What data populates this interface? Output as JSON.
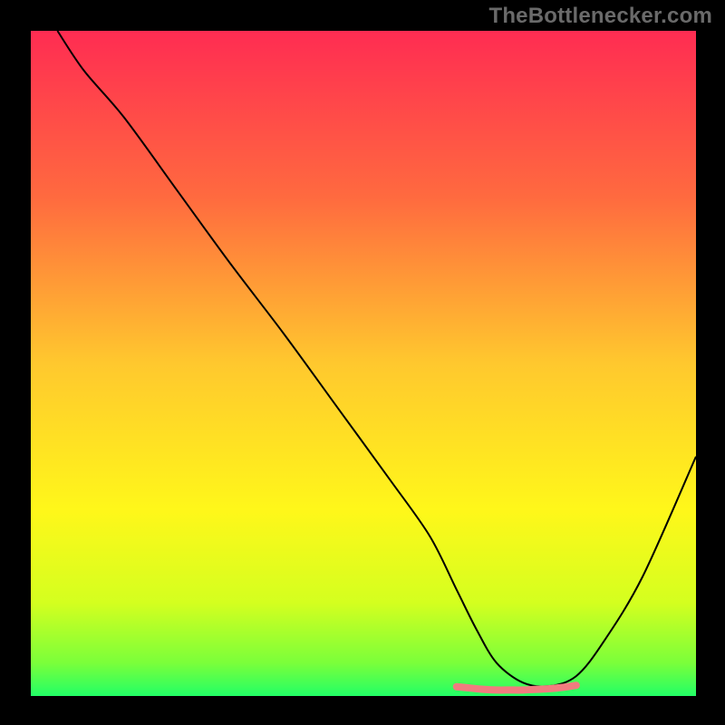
{
  "watermark": "TheBottlenecker.com",
  "chart_data": {
    "type": "line",
    "title": "",
    "xlabel": "",
    "ylabel": "",
    "xlim": [
      0,
      100
    ],
    "ylim": [
      0,
      100
    ],
    "gradient_stops": [
      {
        "offset": 0,
        "color": "#ff2c52"
      },
      {
        "offset": 25,
        "color": "#ff6a3f"
      },
      {
        "offset": 50,
        "color": "#ffc82e"
      },
      {
        "offset": 72,
        "color": "#fff71a"
      },
      {
        "offset": 86,
        "color": "#d4ff1f"
      },
      {
        "offset": 95,
        "color": "#7bff3a"
      },
      {
        "offset": 100,
        "color": "#22ff66"
      }
    ],
    "series": [
      {
        "name": "curve",
        "color": "#000000",
        "width": 2,
        "x": [
          4,
          8,
          14,
          22,
          30,
          38,
          46,
          54,
          60,
          64,
          67,
          70,
          74,
          78,
          82,
          86,
          92,
          100
        ],
        "y": [
          100,
          94,
          87,
          76,
          65,
          54.5,
          43.5,
          32.5,
          24,
          16,
          10,
          5,
          2,
          1.5,
          3,
          8,
          18,
          36
        ]
      },
      {
        "name": "bottom-highlight",
        "color": "#f17c7f",
        "width": 8,
        "x": [
          64,
          66,
          68,
          70,
          72,
          74,
          76,
          78,
          80,
          82
        ],
        "y": [
          1.4,
          1.2,
          1.0,
          0.9,
          0.9,
          0.9,
          1.0,
          1.1,
          1.3,
          1.6
        ]
      }
    ]
  }
}
